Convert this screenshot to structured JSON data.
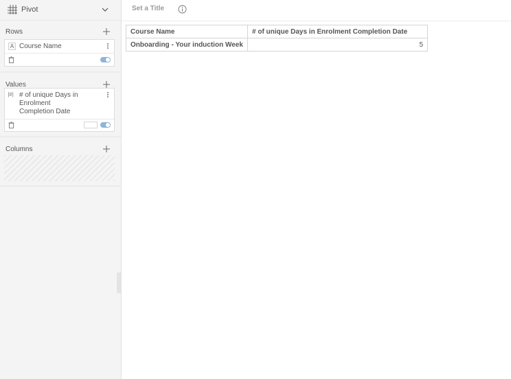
{
  "header": {
    "visualization_type": "Pivot",
    "viz_icon": "grid-icon",
    "chevron_icon": "chevron-down-icon"
  },
  "sidebar": {
    "rows": {
      "title": "Rows",
      "fields": [
        {
          "type_badge": "A",
          "label": "Course Name"
        }
      ]
    },
    "values": {
      "title": "Values",
      "fields": [
        {
          "type_badge": "|#|",
          "label": "# of unique Days in Enrolment Completion Date"
        }
      ]
    },
    "columns": {
      "title": "Columns"
    }
  },
  "main": {
    "title_placeholder": "Set a Title",
    "table": {
      "headers": [
        "Course Name",
        "# of unique Days in Enrolment Completion Date"
      ],
      "rows": [
        [
          "Onboarding - Your induction Week",
          "5"
        ]
      ]
    }
  },
  "colors": {
    "toggle_on": "#8fb4d8",
    "sidebar_bg": "#f4f4f4",
    "border": "#d4d4d4"
  }
}
